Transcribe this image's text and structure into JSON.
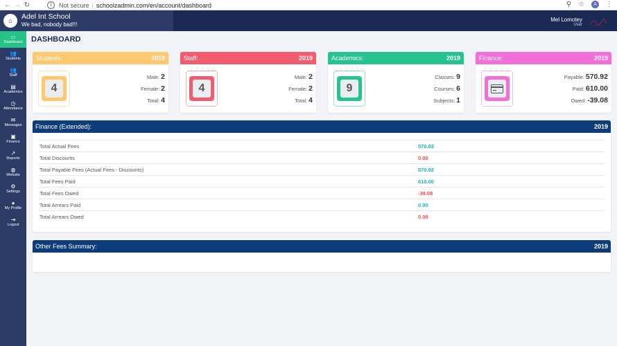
{
  "browser": {
    "not_secure": "Not secure",
    "url": "schoolzadmin.com/en/account/dashboard",
    "profile_initial": "A"
  },
  "app": {
    "school_name": "Adel Int School",
    "tagline": "We bad, nobody bad!!!",
    "user_name": "Mel Lomotey",
    "user_role": "User"
  },
  "sidebar": {
    "items": [
      {
        "label": "Dashboard",
        "icon": "monitor-icon",
        "glyph": "▭"
      },
      {
        "label": "Students",
        "icon": "users-icon",
        "glyph": "👥"
      },
      {
        "label": "Staff",
        "icon": "users-icon",
        "glyph": "👥"
      },
      {
        "label": "Academics",
        "icon": "book-icon",
        "glyph": "▤"
      },
      {
        "label": "Attendance",
        "icon": "clock-icon",
        "glyph": "◷"
      },
      {
        "label": "Messages",
        "icon": "envelope-icon",
        "glyph": "✉"
      },
      {
        "label": "Finance",
        "icon": "money-icon",
        "glyph": "▣"
      },
      {
        "label": "Reports",
        "icon": "chart-icon",
        "glyph": "↗"
      },
      {
        "label": "Website",
        "icon": "globe-icon",
        "glyph": "◍"
      },
      {
        "label": "Settings",
        "icon": "gear-icon",
        "glyph": "⚙"
      },
      {
        "label": "My Profile",
        "icon": "user-icon",
        "glyph": "●"
      },
      {
        "label": "Logout",
        "icon": "logout-icon",
        "glyph": "⇥"
      }
    ]
  },
  "page_title": "DASHBOARD",
  "cards": {
    "students": {
      "title": "Students:",
      "year": "2019",
      "count": "4",
      "color": "#fdc86e",
      "stats": [
        {
          "label": "Male:",
          "value": "2"
        },
        {
          "label": "Female:",
          "value": "2"
        },
        {
          "label": "Total:",
          "value": "4"
        }
      ]
    },
    "staff": {
      "title": "Staff:",
      "year": "2019",
      "count": "4",
      "color": "#f15c6e",
      "stats": [
        {
          "label": "Male:",
          "value": "2"
        },
        {
          "label": "Female:",
          "value": "2"
        },
        {
          "label": "Total:",
          "value": "4"
        }
      ]
    },
    "academics": {
      "title": "Academics:",
      "year": "2019",
      "count": "9",
      "color": "#26c290",
      "stats": [
        {
          "label": "Classes:",
          "value": "9"
        },
        {
          "label": "Courses:",
          "value": "6"
        },
        {
          "label": "Subjects:",
          "value": "1"
        }
      ]
    },
    "finance": {
      "title": "Finance:",
      "year": "2019",
      "color": "#f16fd6",
      "icon": "credit-card-icon",
      "stats": [
        {
          "label": "Payable:",
          "value": "570.92"
        },
        {
          "label": "Paid:",
          "value": "610.00"
        },
        {
          "label": "Owed:",
          "value": "-39.08"
        }
      ]
    }
  },
  "finance_extended": {
    "title": "Finance (Extended):",
    "year": "2019",
    "rows": [
      {
        "label": "Total Actual Fees",
        "value": "570.92",
        "color": "#1ab0b8"
      },
      {
        "label": "Total Discounts",
        "value": "0.00",
        "color": "#ee4a4a"
      },
      {
        "label": "Total Payable Fees (Actual Fees - Discounts)",
        "value": "570.92",
        "color": "#1ab0b8"
      },
      {
        "label": "Total Fees Paid",
        "value": "610.00",
        "color": "#1ab0b8"
      },
      {
        "label": "Total Fees Owed",
        "value": "-39.08",
        "color": "#ee4a4a"
      },
      {
        "label": "Total Arrears Paid",
        "value": "0.00",
        "color": "#1ab0b8"
      },
      {
        "label": "Total Arrears Owed",
        "value": "0.00",
        "color": "#ee4a4a"
      }
    ]
  },
  "other_fees": {
    "title": "Other Fees Summary:",
    "year": "2019"
  }
}
